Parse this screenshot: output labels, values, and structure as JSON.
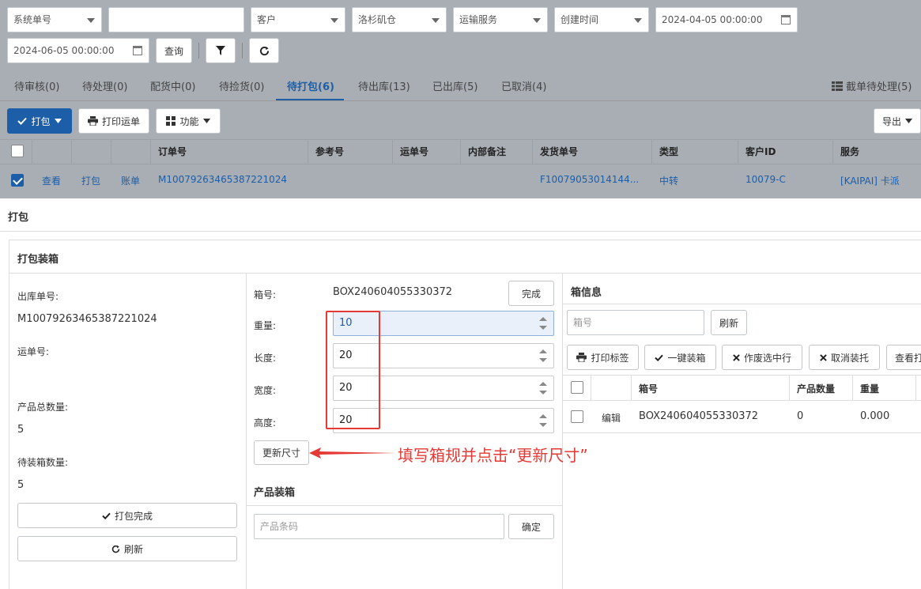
{
  "filters": {
    "system_no": "系统单号",
    "customer_placeholder": "客户",
    "warehouse": "洛杉矶仓",
    "shipping_service_placeholder": "运输服务",
    "time_type": "创建时间",
    "start_time": "2024-04-05 00:00:00",
    "end_time": "2024-06-05 00:00:00",
    "query_label": "查询"
  },
  "tabs": [
    {
      "label": "待审核(0)"
    },
    {
      "label": "待处理(0)"
    },
    {
      "label": "配货中(0)"
    },
    {
      "label": "待捡货(0)"
    },
    {
      "label": "待打包(6)"
    },
    {
      "label": "待出库(13)"
    },
    {
      "label": "已出库(5)"
    },
    {
      "label": "已取消(4)"
    }
  ],
  "cutoff_label": "截单待处理(5)",
  "toolbar": {
    "pack_label": "打包",
    "print_waybill_label": "打印运单",
    "function_label": "功能",
    "export_label": "导出"
  },
  "table": {
    "headers": [
      "订单号",
      "参考号",
      "运单号",
      "内部备注",
      "发货单号",
      "类型",
      "客户ID",
      "服务"
    ],
    "row": {
      "view": "查看",
      "pack": "打包",
      "bill": "账单",
      "order_no": "M10079263465387221024",
      "shipment_no": "F10079053014144...",
      "type": "中转",
      "customer_id": "10079-C",
      "service": "[KAIPAI] 卡派"
    }
  },
  "modal": {
    "title": "打包",
    "section_title": "打包装箱",
    "outbound_no_label": "出库单号:",
    "outbound_no": "M10079263465387221024",
    "waybill_label": "运单号:",
    "total_qty_label": "产品总数量:",
    "total_qty": "5",
    "pending_qty_label": "待装箱数量:",
    "pending_qty": "5",
    "pack_done_label": "打包完成",
    "refresh_label": "刷新",
    "box_no_label": "箱号:",
    "box_no": "BOX240604055330372",
    "complete_label": "完成",
    "weight_label": "重量:",
    "weight": "10",
    "length_label": "长度:",
    "length": "20",
    "width_label": "宽度:",
    "width": "20",
    "height_label": "高度:",
    "height": "20",
    "update_size_label": "更新尺寸",
    "product_pack_title": "产品装箱",
    "barcode_placeholder": "产品条码",
    "confirm_label": "确定",
    "box_info_title": "箱信息",
    "box_search_placeholder": "箱号",
    "box_refresh_label": "刷新",
    "print_label_label": "打印标签",
    "one_click_pack_label": "一键装箱",
    "void_selected_label": "作废选中行",
    "cancel_pallet_label": "取消装托",
    "view_print_label": "查看打",
    "box_table_headers": [
      "箱号",
      "产品数量",
      "重量"
    ],
    "box_row": {
      "edit": "编辑",
      "box_no": "BOX240604055330372",
      "qty": "0",
      "weight": "0.000"
    }
  },
  "annotation": "填写箱规并点击“更新尺寸”",
  "colors": {
    "primary": "#1d5ea8",
    "overlay": "#a9aeb4",
    "annotation_red": "#e53935"
  }
}
